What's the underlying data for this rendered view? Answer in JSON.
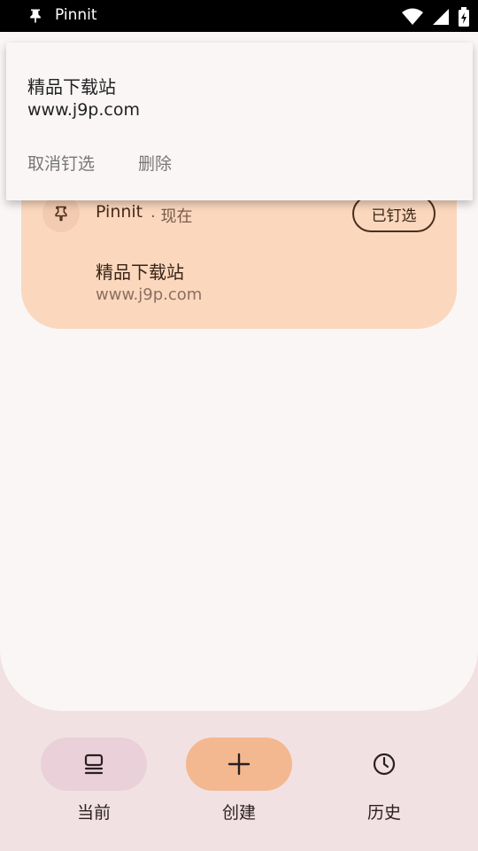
{
  "status_bar": {
    "app_name": "Pinnit"
  },
  "popup": {
    "title": "精品下载站",
    "url": "www.j9p.com",
    "actions": {
      "unpin": "取消钉选",
      "delete": "删除"
    }
  },
  "notification_card": {
    "app_name": "Pinnit",
    "time": "· 现在",
    "pinned_label": "已钉选",
    "title": "精品下载站",
    "url": "www.j9p.com"
  },
  "bottom_nav": {
    "items": [
      {
        "label": "当前",
        "icon": "current-icon",
        "pill_color": "#ead0d8"
      },
      {
        "label": "创建",
        "icon": "plus-icon",
        "pill_color": "#f3b88f"
      },
      {
        "label": "历史",
        "icon": "clock-icon",
        "pill_color": "transparent"
      }
    ]
  },
  "colors": {
    "background": "#f1e1e3",
    "sheet": "#fbf6f6",
    "card": "#fbd8bd",
    "accent": "#f3b88f"
  }
}
